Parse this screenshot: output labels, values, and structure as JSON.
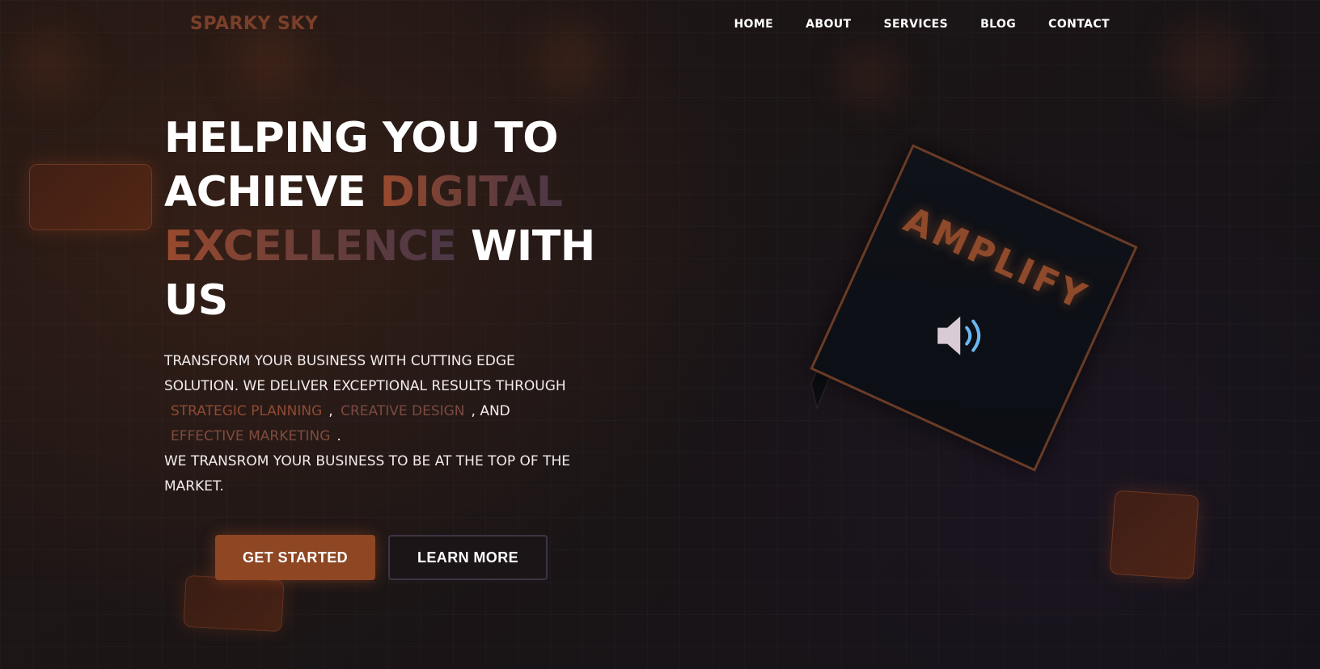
{
  "brand": {
    "name": "SPARKY SKY",
    "color": "#7a3f29"
  },
  "nav": {
    "items": [
      {
        "label": "HOME"
      },
      {
        "label": "ABOUT"
      },
      {
        "label": "SERVICES"
      },
      {
        "label": "BLOG"
      },
      {
        "label": "CONTACT"
      }
    ]
  },
  "hero": {
    "headline": {
      "line1": "HELPING YOU TO",
      "line2_plain": "ACHIEVE",
      "accent1": "DIGITAL",
      "accent2": "EXCELLENCE",
      "tail": "WITH",
      "line4": "US"
    },
    "description": {
      "intro": "TRANSFORM YOUR BUSINESS WITH CUTTING EDGE SOLUTION. WE DELIVER EXCEPTIONAL RESULTS THROUGH",
      "highlight1": "STRATEGIC PLANNING",
      "sep1": ",",
      "highlight2": "CREATIVE DESIGN",
      "sep2": ", AND",
      "highlight3": "EFFECTIVE MARKETING",
      "end": ".",
      "outro": "WE TRANSROM YOUR BUSINESS TO BE AT THE TOP OF THE MARKET."
    },
    "primary_button": "GET STARTED",
    "secondary_button": "LEARN MORE"
  },
  "cube": {
    "label": "AMPLIFY",
    "icon": "speaker-volume-icon"
  },
  "colors": {
    "accent": "#8e4623",
    "background": "#1a1417",
    "text": "#ffffff"
  }
}
